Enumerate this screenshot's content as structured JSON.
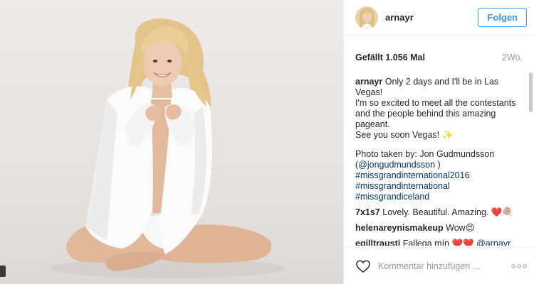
{
  "header": {
    "username": "arnayr",
    "follow_label": "Folgen"
  },
  "meta": {
    "likes": "Gefällt 1.056 Mal",
    "time": "2Wo."
  },
  "caption": {
    "username": "arnayr",
    "line1": "Only 2 days and I'll be in Las Vegas!",
    "line2": "I'm so excited to meet all the contestants and the people behind this amazing pageant.",
    "line3": "See you soon Vegas! ✨",
    "credit": "Photo taken by: Jon Gudmundsson",
    "credit_mention_open": "(",
    "credit_mention": "@jongudmundsson",
    "credit_mention_close": " )",
    "hashtags": [
      "#missgrandinternational2016",
      "#missgrandinternational",
      "#missgrandiceland"
    ]
  },
  "comments": [
    {
      "username": "7x1s7",
      "text": "Lovely. Beautiful. Amazing. ❤️🍭"
    },
    {
      "username": "helenareynismakeup",
      "text": "Wow😍"
    },
    {
      "username": "egilltrausti",
      "text": "Fallega mín ❤️❤️",
      "mention": "@arnayr"
    }
  ],
  "footer": {
    "comment_placeholder": "Kommentar hinzufügen ..."
  },
  "icons": {
    "heart": "heart-outline-icon",
    "more": "more-options-icon"
  },
  "colors": {
    "accent": "#3897f0",
    "link": "#003569",
    "muted": "#999999"
  }
}
